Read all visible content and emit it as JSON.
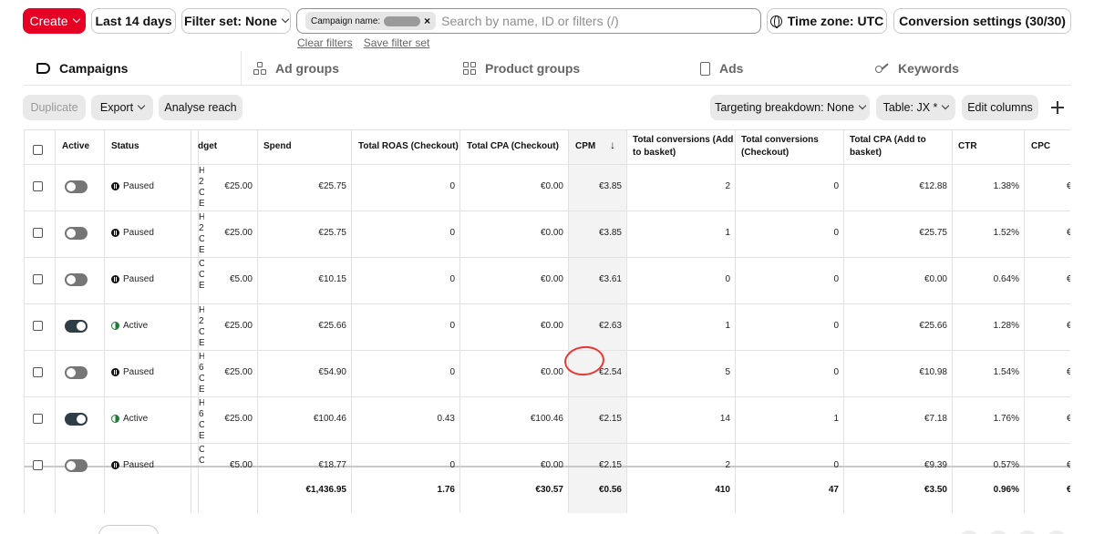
{
  "topbar": {
    "create_label": "Create",
    "date_range_label": "Last 14 days",
    "filter_set_label": "Filter set: None",
    "search_chip_label": "Campaign name:",
    "search_placeholder": "Search by name, ID or filters (/)",
    "timezone_label": "Time zone: UTC",
    "conversion_settings_label": "Conversion settings (30/30)",
    "clear_filters_label": "Clear filters",
    "save_filter_set_label": "Save filter set"
  },
  "tabs": [
    {
      "label": "Campaigns",
      "icon": "megaphone-icon",
      "active": true
    },
    {
      "label": "Ad groups",
      "icon": "ad-groups-icon",
      "active": false
    },
    {
      "label": "Product groups",
      "icon": "grid-icon",
      "active": false
    },
    {
      "label": "Ads",
      "icon": "mobile-icon",
      "active": false
    },
    {
      "label": "Keywords",
      "icon": "key-icon",
      "active": false
    }
  ],
  "toolbar": {
    "duplicate_label": "Duplicate",
    "export_label": "Export",
    "analyse_reach_label": "Analyse reach",
    "targeting_breakdown_label": "Targeting breakdown: None",
    "table_label": "Table: JX *",
    "edit_columns_label": "Edit columns"
  },
  "table": {
    "headers": {
      "active": "Active",
      "status": "Status",
      "budget": "dget",
      "spend": "Spend",
      "roas": "Total ROAS (Checkout)",
      "cpa": "Total CPA (Checkout)",
      "cpm": "CPM",
      "conv_add_1": "Total conversions (Add",
      "conv_add_2": "to basket)",
      "conv_chk_1": "Total conversions",
      "conv_chk_2": "(Checkout)",
      "cpa_add_1": "Total CPA (Add to",
      "cpa_add_2": "basket)",
      "ctr": "CTR",
      "cpc": "CPC",
      "sort_arrow": "↓"
    },
    "rows": [
      {
        "active": false,
        "status": "Paused",
        "name": [
          "H",
          "2",
          "C",
          "E"
        ],
        "budget": "€25.00",
        "spend": "€25.75",
        "roas": "0",
        "cpa": "€0.00",
        "cpm": "€3.85",
        "conv_add": "2",
        "conv_chk": "0",
        "cpa_add": "€12.88",
        "ctr": "1.38%",
        "cpc": "€"
      },
      {
        "active": false,
        "status": "Paused",
        "name": [
          "H",
          "2",
          "C",
          "E"
        ],
        "budget": "€25.00",
        "spend": "€25.75",
        "roas": "0",
        "cpa": "€0.00",
        "cpm": "€3.85",
        "conv_add": "1",
        "conv_chk": "0",
        "cpa_add": "€25.75",
        "ctr": "1.52%",
        "cpc": "€"
      },
      {
        "active": false,
        "status": "Paused",
        "name": [
          "C",
          "C",
          "E"
        ],
        "budget": "€5.00",
        "spend": "€10.15",
        "roas": "0",
        "cpa": "€0.00",
        "cpm": "€3.61",
        "conv_add": "0",
        "conv_chk": "0",
        "cpa_add": "€0.00",
        "ctr": "0.64%",
        "cpc": "€"
      },
      {
        "active": true,
        "status": "Active",
        "name": [
          "H",
          "2",
          "C",
          "E"
        ],
        "budget": "€25.00",
        "spend": "€25.66",
        "roas": "0",
        "cpa": "€0.00",
        "cpm": "€2.63",
        "conv_add": "1",
        "conv_chk": "0",
        "cpa_add": "€25.66",
        "ctr": "1.28%",
        "cpc": "€"
      },
      {
        "active": false,
        "status": "Paused",
        "name": [
          "H",
          "6",
          "C",
          "E"
        ],
        "budget": "€25.00",
        "spend": "€54.90",
        "roas": "0",
        "cpa": "€0.00",
        "cpm": "€2.54",
        "conv_add": "5",
        "conv_chk": "0",
        "cpa_add": "€10.98",
        "ctr": "1.54%",
        "cpc": "€"
      },
      {
        "active": true,
        "status": "Active",
        "name": [
          "H",
          "6",
          "C",
          "E"
        ],
        "budget": "€25.00",
        "spend": "€100.46",
        "roas": "0.43",
        "cpa": "€100.46",
        "cpm": "€2.15",
        "conv_add": "14",
        "conv_chk": "1",
        "cpa_add": "€7.18",
        "ctr": "1.76%",
        "cpc": "€"
      },
      {
        "active": false,
        "status": "Paused",
        "name": [
          "C",
          "C"
        ],
        "budget": "€5.00",
        "spend": "€18.77",
        "roas": "0",
        "cpa": "€0.00",
        "cpm": "€2.15",
        "conv_add": "2",
        "conv_chk": "0",
        "cpa_add": "€9.39",
        "ctr": "0.57%",
        "cpc": "€"
      }
    ],
    "totals": {
      "spend": "€1,436.95",
      "roas": "1.76",
      "cpa": "€30.57",
      "cpm": "€0.56",
      "conv_add": "410",
      "conv_chk": "47",
      "cpa_add": "€3.50",
      "ctr": "0.96%",
      "cpc": "€"
    }
  },
  "colors": {
    "brand": "#e60023",
    "annotation": "#e53935",
    "toggle_on": "#2f3e46",
    "active_status": "#1f7a3a"
  }
}
